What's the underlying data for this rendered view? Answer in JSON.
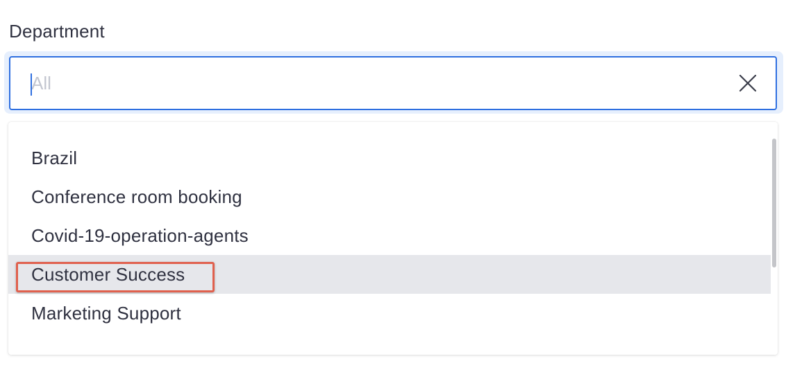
{
  "field": {
    "label": "Department",
    "placeholder": "All",
    "value": ""
  },
  "icons": {
    "clear": "close-icon"
  },
  "dropdown": {
    "options": [
      {
        "label": "Brazil"
      },
      {
        "label": "Conference room booking"
      },
      {
        "label": "Covid-19-operation-agents"
      },
      {
        "label": "Customer Success"
      },
      {
        "label": "Marketing Support"
      }
    ],
    "hovered_option": "Customer Success"
  },
  "colors": {
    "focus_border": "#2e6fe0",
    "focus_ring": "#e6effd",
    "hover_bg": "#e6e7eb",
    "highlight_box": "#e0604d"
  }
}
